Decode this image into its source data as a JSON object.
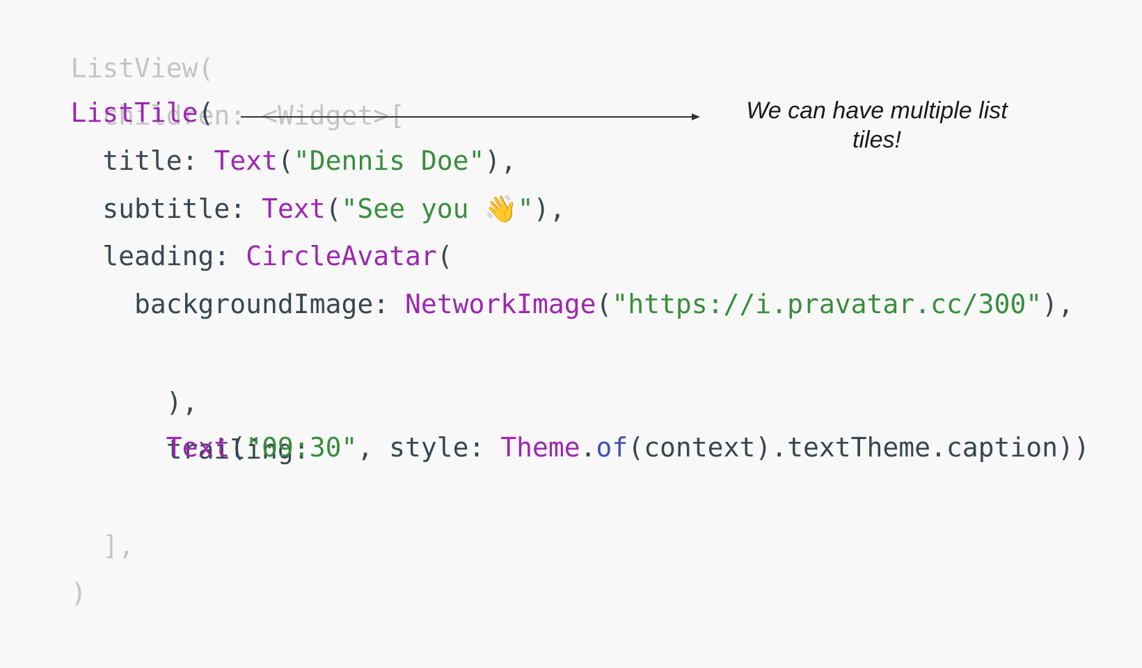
{
  "code": {
    "line1": {
      "text": "ListView("
    },
    "line2": {
      "text": "  children: <Widget>["
    },
    "line3": {
      "indent": "    ",
      "tile": "ListTile",
      "paren": "("
    },
    "line4": {
      "indent": "      ",
      "key": "title: ",
      "cls": "Text",
      "open": "(",
      "str": "\"Dennis Doe\"",
      "close": "),"
    },
    "line5": {
      "indent": "      ",
      "key": "subtitle: ",
      "cls": "Text",
      "open": "(",
      "str_open": "\"See you ",
      "emoji": "👋",
      "str_close": "\"",
      "close": "),"
    },
    "line6": {
      "indent": "      ",
      "key": "leading: ",
      "cls": "CircleAvatar",
      "open": "("
    },
    "line7": {
      "indent": "        ",
      "key": "backgroundImage: ",
      "cls": "NetworkImage",
      "open": "(",
      "str": "\"https://i.pravatar.cc/300\"",
      "close": "),"
    },
    "line8": {
      "text": "      ),"
    },
    "line9": {
      "text": "      trailing:"
    },
    "line10": {
      "indent": "          ",
      "cls": "Text",
      "open": "(",
      "str": "\"09:30\"",
      "mid": ", style: ",
      "theme": "Theme",
      "dot": ".",
      "of": "of",
      "rest": "(context).textTheme.caption))"
    },
    "line11": {
      "text": "  ],"
    },
    "line12": {
      "text": ")"
    }
  },
  "annotation": {
    "text": "We can have multiple list tiles!"
  },
  "colors": {
    "background": "#f8f8f8",
    "faded": "#c4c4c4",
    "plain": "#37474f",
    "keyword": "#9c27b0",
    "string": "#388e3c",
    "method": "#3f51b5"
  }
}
